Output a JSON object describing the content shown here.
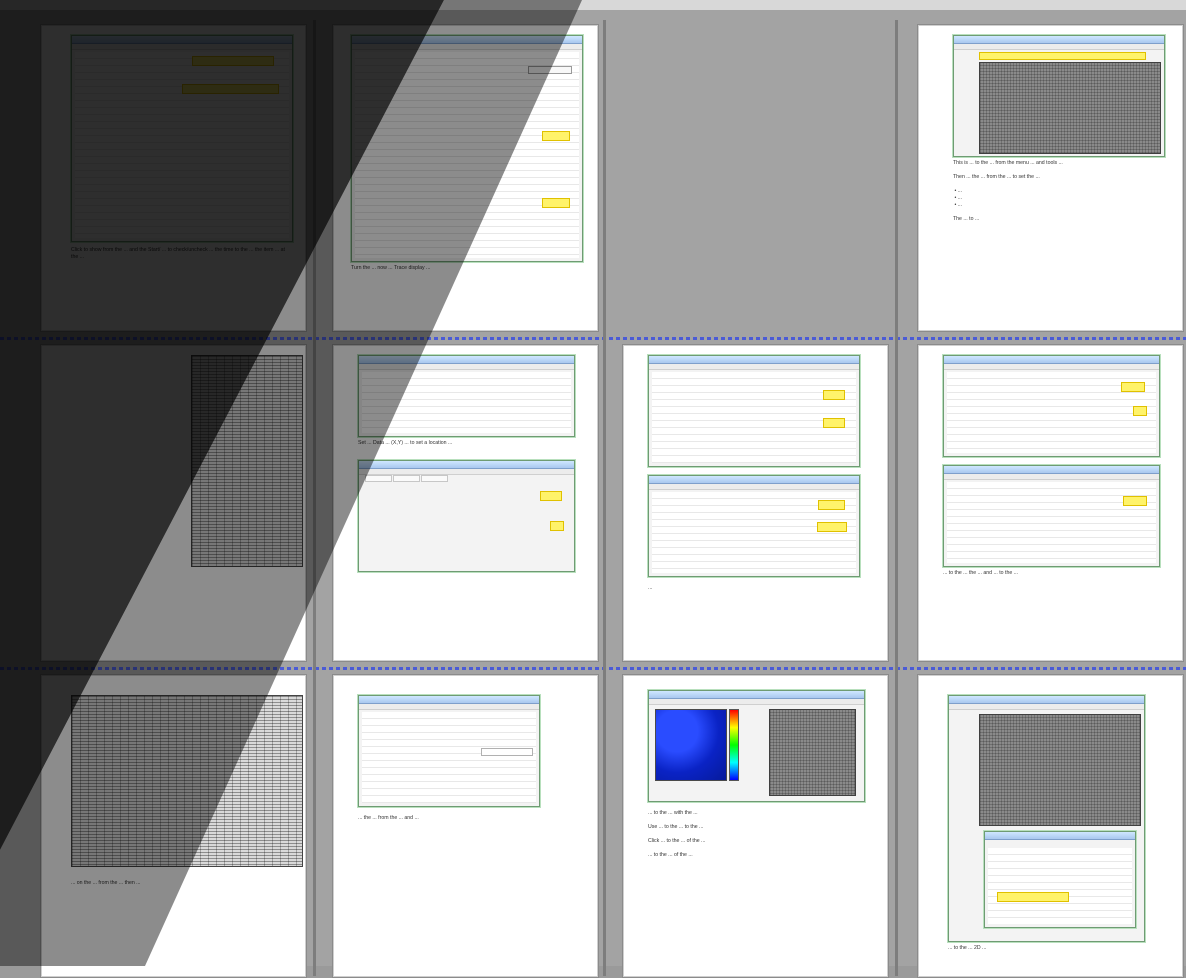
{
  "pages": {
    "p1_caption": "Click to show from the ... and the Start/ ... to check/uncheck ... the time to the ... the item ... at the ...",
    "p2_caption": "Turn the ... now ... Trace display ...",
    "p3_caption": "This is ... to the ... from the menu ... and tools ...\n\nThen ... the ... from the ... to set the ...\n\n • ...\n • ...\n • ...\n\nThe ... to ...",
    "p5_caption": "Set ... Data ... (X,Y) ... to set a location ...",
    "p6_caption": "...",
    "p7_caption": "... to the ... the ... and ... to the ...",
    "p8_caption": "... on the ... from the ... then ...",
    "p9_caption": "... the ... from the ... and ...",
    "p10_caption": "... to the ... with the ...\n\nUse ... to the ... to the ...\n\nClick ... to the ... of the ...\n\n... to the ... of the ...",
    "p11_caption": "... to the ... 2D ..."
  },
  "colors": {
    "page_bg": "#ffffff",
    "app_bg": "#a3a3a3",
    "separator_dash": "#4b5bd6",
    "highlight_yellow": "#fff36a",
    "window_border_green": "#6f9b73",
    "overlay_dark": "#000000"
  }
}
